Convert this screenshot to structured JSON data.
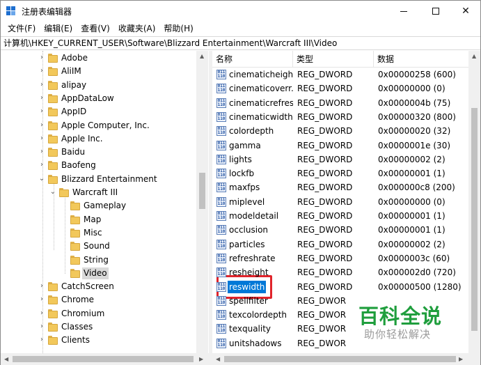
{
  "window": {
    "title": "注册表编辑器",
    "controls": {
      "minimize": "—",
      "maximize": "□",
      "close": "✕"
    }
  },
  "menu": [
    "文件(F)",
    "编辑(E)",
    "查看(V)",
    "收藏夹(A)",
    "帮助(H)"
  ],
  "address": "计算机\\HKEY_CURRENT_USER\\Software\\Blizzard Entertainment\\Warcraft III\\Video",
  "tree": [
    {
      "label": "Adobe",
      "level": 0,
      "expandable": true
    },
    {
      "label": "AliIM",
      "level": 0,
      "expandable": true
    },
    {
      "label": "alipay",
      "level": 0,
      "expandable": true
    },
    {
      "label": "AppDataLow",
      "level": 0,
      "expandable": true
    },
    {
      "label": "AppID",
      "level": 0,
      "expandable": true
    },
    {
      "label": "Apple Computer, Inc.",
      "level": 0,
      "expandable": true
    },
    {
      "label": "Apple Inc.",
      "level": 0,
      "expandable": true
    },
    {
      "label": "Baidu",
      "level": 0,
      "expandable": true
    },
    {
      "label": "Baofeng",
      "level": 0,
      "expandable": true
    },
    {
      "label": "Blizzard Entertainment",
      "level": 0,
      "expanded": true
    },
    {
      "label": "Warcraft III",
      "level": 1,
      "expanded": true
    },
    {
      "label": "Gameplay",
      "level": 2,
      "expandable": false
    },
    {
      "label": "Map",
      "level": 2,
      "expandable": false
    },
    {
      "label": "Misc",
      "level": 2,
      "expandable": false
    },
    {
      "label": "Sound",
      "level": 2,
      "expandable": false
    },
    {
      "label": "String",
      "level": 2,
      "expandable": false
    },
    {
      "label": "Video",
      "level": 2,
      "expandable": false,
      "selected": true
    },
    {
      "label": "CatchScreen",
      "level": 0,
      "expandable": true
    },
    {
      "label": "Chrome",
      "level": 0,
      "expandable": true
    },
    {
      "label": "Chromium",
      "level": 0,
      "expandable": true
    },
    {
      "label": "Classes",
      "level": 0,
      "expandable": true
    },
    {
      "label": "Clients",
      "level": 0,
      "expandable": true
    }
  ],
  "columns": {
    "name": "名称",
    "type": "类型",
    "data": "数据"
  },
  "values": [
    {
      "name": "cinematicheight",
      "type": "REG_DWORD",
      "data": "0x00000258 (600)"
    },
    {
      "name": "cinematicoverr...",
      "type": "REG_DWORD",
      "data": "0x00000000 (0)"
    },
    {
      "name": "cinematicrefresh",
      "type": "REG_DWORD",
      "data": "0x0000004b (75)"
    },
    {
      "name": "cinematicwidth",
      "type": "REG_DWORD",
      "data": "0x00000320 (800)"
    },
    {
      "name": "colordepth",
      "type": "REG_DWORD",
      "data": "0x00000020 (32)"
    },
    {
      "name": "gamma",
      "type": "REG_DWORD",
      "data": "0x0000001e (30)"
    },
    {
      "name": "lights",
      "type": "REG_DWORD",
      "data": "0x00000002 (2)"
    },
    {
      "name": "lockfb",
      "type": "REG_DWORD",
      "data": "0x00000001 (1)"
    },
    {
      "name": "maxfps",
      "type": "REG_DWORD",
      "data": "0x000000c8 (200)"
    },
    {
      "name": "miplevel",
      "type": "REG_DWORD",
      "data": "0x00000000 (0)"
    },
    {
      "name": "modeldetail",
      "type": "REG_DWORD",
      "data": "0x00000001 (1)"
    },
    {
      "name": "occlusion",
      "type": "REG_DWORD",
      "data": "0x00000001 (1)"
    },
    {
      "name": "particles",
      "type": "REG_DWORD",
      "data": "0x00000002 (2)"
    },
    {
      "name": "refreshrate",
      "type": "REG_DWORD",
      "data": "0x0000003c (60)"
    },
    {
      "name": "resheight",
      "type": "REG_DWORD",
      "data": "0x000002d0 (720)"
    },
    {
      "name": "reswidth",
      "type": "REG_DWORD",
      "data": "0x00000500 (1280)",
      "selected": true
    },
    {
      "name": "spellfilter",
      "type": "REG_DWOR",
      "data": ""
    },
    {
      "name": "texcolordepth",
      "type": "REG_DWOR",
      "data": ""
    },
    {
      "name": "texquality",
      "type": "REG_DWOR",
      "data": ""
    },
    {
      "name": "unitshadows",
      "type": "REG_DWOR",
      "data": ""
    }
  ],
  "watermark": {
    "main": "百科全说",
    "sub": "助你轻松解决"
  },
  "colors": {
    "selection": "#0078d7",
    "highlight_box": "#e0242b",
    "watermark_green": "#1f9e3d",
    "folder": "#f2c85b"
  }
}
